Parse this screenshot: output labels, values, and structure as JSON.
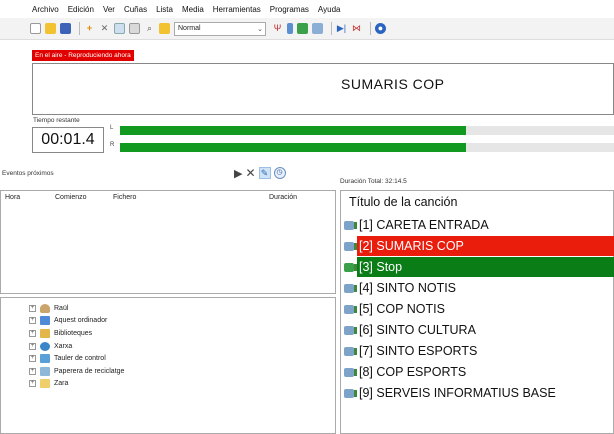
{
  "menu": [
    "Archivo",
    "Edición",
    "Ver",
    "Cuñas",
    "Lista",
    "Media",
    "Herramientas",
    "Programas",
    "Ayuda"
  ],
  "toolbar": {
    "mode_value": "Normal"
  },
  "on_air": {
    "badge": "En el aire - Reproduciendo ahora",
    "title": "SUMARIS COP",
    "remaining_label": "Tiempo restante",
    "remaining_time": "00:01.4",
    "vu": {
      "left_label": "L",
      "right_label": "R",
      "left_level": 0.7,
      "right_level": 0.7
    }
  },
  "events": {
    "label": "Eventos próximos",
    "columns": {
      "hour": "Hora",
      "start": "Comienzo",
      "file": "Fichero",
      "duration": "Duración"
    }
  },
  "tree": [
    "Raül",
    "Aquest ordinador",
    "Biblioteques",
    "Xarxa",
    "Tauler de control",
    "Paperera de reciclatge",
    "Zara"
  ],
  "playlist": {
    "total_duration": "Duración Total: 32:14.5",
    "column_title": "Título de la canción",
    "items": [
      "[1] CARETA ENTRADA",
      "[2] SUMARIS COP",
      "[3] Stop",
      "[4] SINTO NOTIS",
      "[5] COP NOTIS",
      "[6] SINTO CULTURA",
      "[7] SINTO ESPORTS",
      "[8] COP ESPORTS",
      "[9] SERVEIS INFORMATIUS BASE"
    ]
  },
  "colors": {
    "on_air_red": "#e00000",
    "playing_red": "#ea1c0c",
    "stop_green": "#0a7d17",
    "vu_green": "#129a20"
  }
}
